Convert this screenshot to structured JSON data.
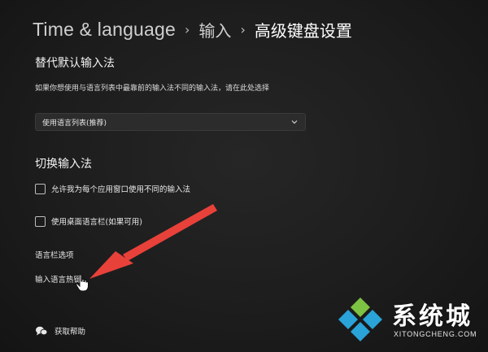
{
  "breadcrumb": {
    "root": "Time & language",
    "middle": "输入",
    "current": "高级键盘设置",
    "separator": "›"
  },
  "override_section": {
    "title": "替代默认输入法",
    "description": "如果你想使用与语言列表中最靠前的输入法不同的输入法，请在此处选择",
    "dropdown_value": "使用语言列表(推荐)"
  },
  "switch_section": {
    "title": "切换输入法",
    "options": [
      {
        "label": "允许我为每个应用窗口使用不同的输入法",
        "checked": false
      },
      {
        "label": "使用桌面语言栏(如果可用)",
        "checked": false
      }
    ],
    "links": {
      "language_bar": "语言栏选项",
      "hotkeys": "输入语言热键"
    }
  },
  "help": {
    "label": "获取帮助",
    "icon": "help-chat-icon"
  },
  "annotation": {
    "arrow_color": "#e8413a"
  },
  "watermark": {
    "name": "系统城",
    "domain": "XITONGCHENG.COM",
    "colors": [
      "#29a3d8",
      "#7dc242"
    ]
  }
}
